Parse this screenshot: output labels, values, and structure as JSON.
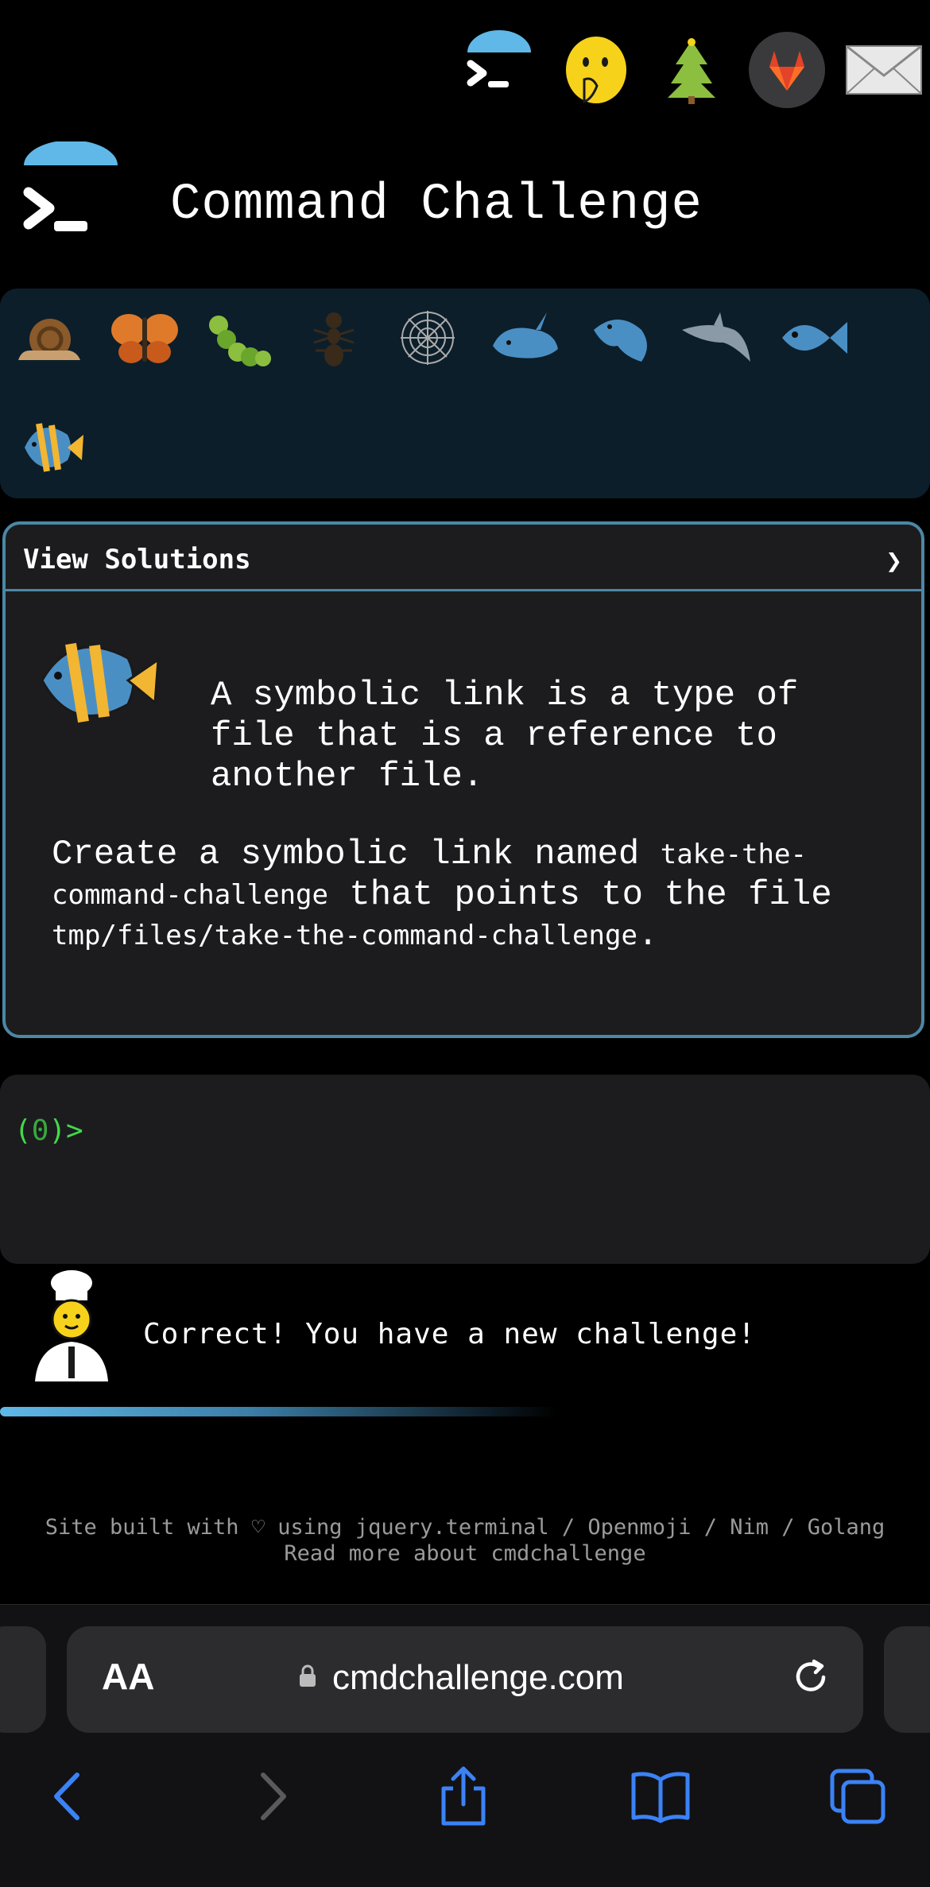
{
  "header": {
    "title": "Command Challenge",
    "top_icons": [
      "terminal-icon",
      "face-with-hand-over-mouth-icon",
      "christmas-tree-icon",
      "gitlab-icon",
      "envelope-icon"
    ]
  },
  "progress_strip": {
    "critters": [
      "snail",
      "butterfly",
      "caterpillar",
      "ant",
      "spider-web",
      "whale",
      "whale-2",
      "dolphin",
      "fish",
      "tropical-fish"
    ]
  },
  "panel": {
    "header_label": "View Solutions",
    "chevron": "❯",
    "intro": "A symbolic link is a type of\nfile that is a reference to\nanother file.",
    "task_pre": "Create a symbolic link named ",
    "task_code1": "take-the-command-challenge",
    "task_mid": " that points to the file ",
    "task_code2": "tmp/files/take-the-command-challenge",
    "task_post": "."
  },
  "terminal": {
    "prompt_open": "(",
    "prompt_num": "0",
    "prompt_close": ")>"
  },
  "feedback": {
    "message": "Correct! You have a new challenge!"
  },
  "footer": {
    "line1": "Site built with ♡ using jquery.terminal / Openmoji / Nim / Golang",
    "line2": "Read more about cmdchallenge"
  },
  "browser": {
    "text_size_label": "AA",
    "url": "cmdchallenge.com"
  },
  "colors": {
    "accent": "#5fb8e8",
    "panel_border": "#4c87a6",
    "prompt": "#42d94b"
  }
}
